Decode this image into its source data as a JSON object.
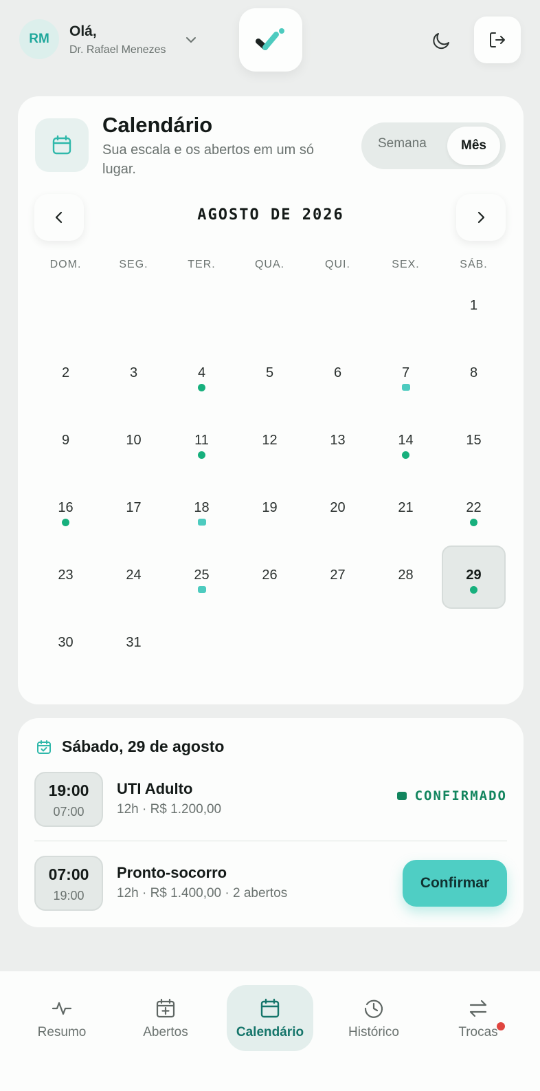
{
  "header": {
    "avatar_initials": "RM",
    "greeting": "Olá,",
    "user_name": "Dr. Rafael Menezes"
  },
  "calendar": {
    "title": "Calendário",
    "subtitle": "Sua escala e os abertos em um só lugar.",
    "view_week": "Semana",
    "view_month": "Mês",
    "view_selected": "Mês",
    "month_label": "AGOSTO DE 2026",
    "weekdays": [
      "DOM.",
      "SEG.",
      "TER.",
      "QUA.",
      "QUI.",
      "SEX.",
      "SÁB."
    ],
    "days": {
      "d1": "1",
      "d2": "2",
      "d3": "3",
      "d4": "4",
      "d5": "5",
      "d6": "6",
      "d7": "7",
      "d8": "8",
      "d9": "9",
      "d10": "10",
      "d11": "11",
      "d12": "12",
      "d13": "13",
      "d14": "14",
      "d15": "15",
      "d16": "16",
      "d17": "17",
      "d18": "18",
      "d19": "19",
      "d20": "20",
      "d21": "21",
      "d22": "22",
      "d23": "23",
      "d24": "24",
      "d25": "25",
      "d26": "26",
      "d27": "27",
      "d28": "28",
      "d29": "29",
      "d30": "30",
      "d31": "31"
    },
    "selected_day": "29",
    "legend_colors": {
      "confirmed": "#17b07d",
      "open": "#4dcbbf"
    }
  },
  "day_detail": {
    "title": "Sábado, 29 de agosto",
    "shifts": [
      {
        "start": "19:00",
        "end": "07:00",
        "name": "UTI Adulto",
        "meta": "12h · R$ 1.200,00",
        "status": "CONFIRMADO"
      },
      {
        "start": "07:00",
        "end": "19:00",
        "name": "Pronto-socorro",
        "meta": "12h · R$ 1.400,00 · 2 abertos",
        "action": "Confirmar"
      }
    ]
  },
  "bottom_nav": {
    "items": [
      "Resumo",
      "Abertos",
      "Calendário",
      "Histórico",
      "Trocas"
    ],
    "active": "Calendário"
  }
}
